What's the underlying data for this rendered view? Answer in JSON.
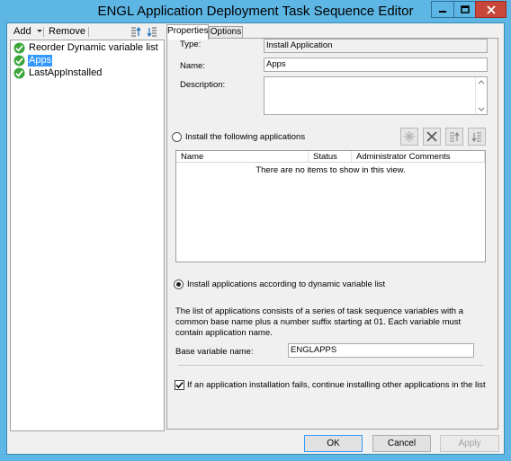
{
  "window": {
    "title": "ENGL Application Deployment Task Sequence Editor",
    "accent": "#5eb6e4",
    "close_color": "#c7473a"
  },
  "left_toolbar": {
    "add_label": "Add",
    "remove_label": "Remove"
  },
  "tree": {
    "items": [
      {
        "label": "Reorder Dynamic variable list",
        "selected": false
      },
      {
        "label": "Apps",
        "selected": true
      },
      {
        "label": "LastAppInstalled",
        "selected": false
      }
    ]
  },
  "tabs": [
    {
      "label": "Properties",
      "active": true
    },
    {
      "label": "Options",
      "active": false
    }
  ],
  "properties": {
    "type_label": "Type:",
    "type_value": "Install Application",
    "name_label": "Name:",
    "name_value": "Apps",
    "description_label": "Description:",
    "description_value": "",
    "radio_install_following": "Install the following applications",
    "list_columns": [
      "Name",
      "Status",
      "Administrator Comments"
    ],
    "list_empty_text": "There are no items to show in this view.",
    "radio_dynamic_list": "Install applications according to dynamic variable list",
    "dynamic_selected": true,
    "dynamic_description": "The list of applications consists of a series of task sequence variables with a common base name plus a number suffix starting at 01.  Each variable must contain application name.",
    "base_variable_label": "Base variable name:",
    "base_variable_value": "ENGLAPPS",
    "continue_on_fail_label": "If an application installation fails, continue installing other applications in the list",
    "continue_on_fail_checked": true
  },
  "buttons": {
    "ok": "OK",
    "cancel": "Cancel",
    "apply": "Apply"
  }
}
